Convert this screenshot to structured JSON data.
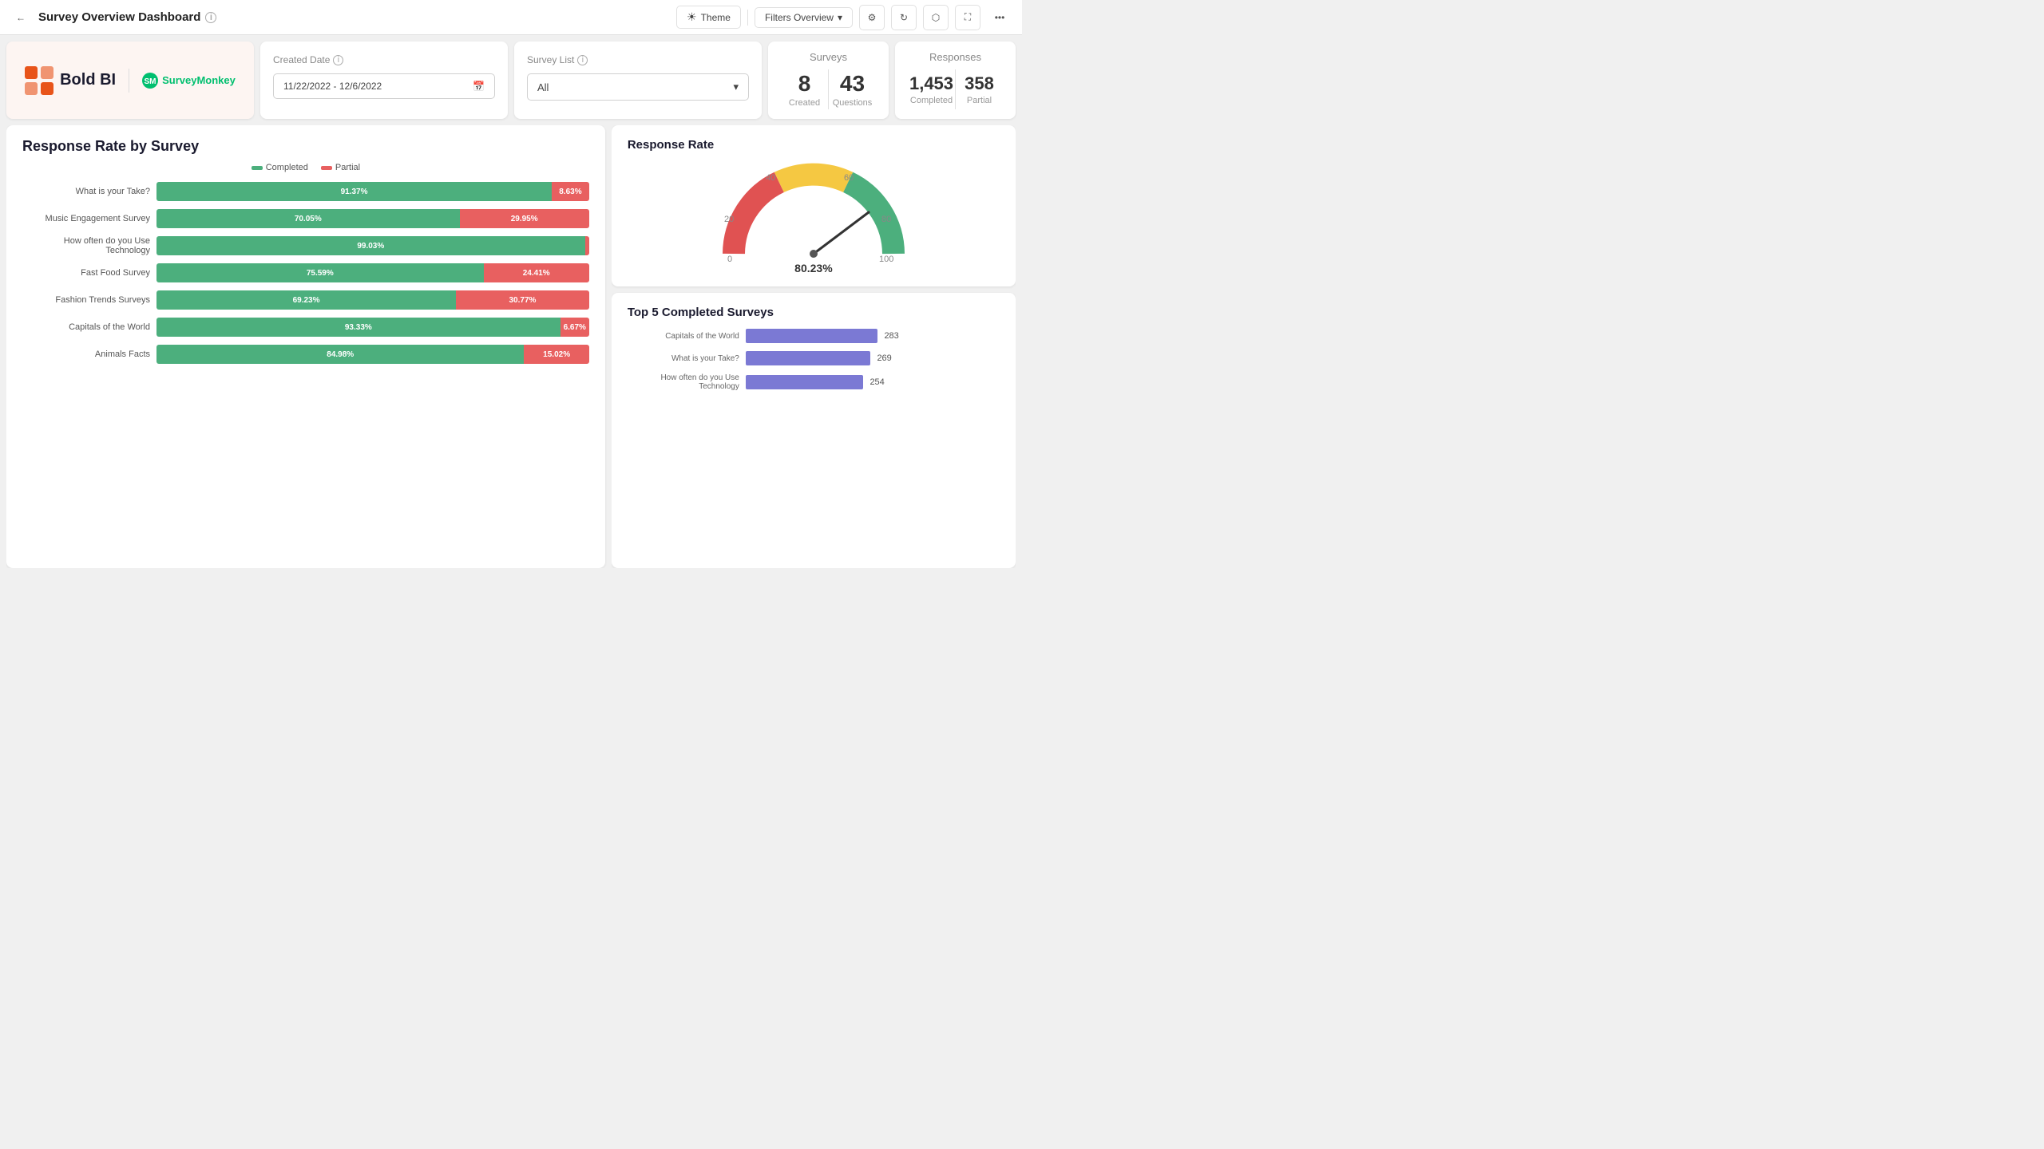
{
  "header": {
    "back_label": "←",
    "title": "Survey Overview Dashboard",
    "theme_label": "Theme",
    "filters_label": "Filters Overview",
    "info_icon": "ℹ",
    "sun_icon": "☀",
    "chevron_icon": "▾",
    "filter_icon": "⚙",
    "refresh_icon": "↻",
    "share_icon": "⬡",
    "expand_icon": "⛶",
    "more_icon": "•••"
  },
  "logo_card": {
    "boldbi_text": "Bold BI",
    "surveymonkey_text": "SurveyMonkey"
  },
  "date_card": {
    "label": "Created Date",
    "value": "11/22/2022 - 12/6/2022",
    "calendar_icon": "📅"
  },
  "survey_list_card": {
    "label": "Survey List",
    "value": "All",
    "chevron": "▾"
  },
  "surveys_card": {
    "title": "Surveys",
    "created_number": "8",
    "created_label": "Created",
    "questions_number": "43",
    "questions_label": "Questions"
  },
  "responses_card": {
    "title": "Responses",
    "completed_number": "1,453",
    "completed_label": "Completed",
    "partial_number": "358",
    "partial_label": "Partial"
  },
  "chart": {
    "title": "Response Rate by Survey",
    "legend_completed": "Completed",
    "legend_partial": "Partial",
    "bars": [
      {
        "label": "What is your Take?",
        "completed": 91.37,
        "partial": 8.63
      },
      {
        "label": "Music Engagement Survey",
        "completed": 70.05,
        "partial": 29.95
      },
      {
        "label": "How often do you Use Technology",
        "completed": 99.03,
        "partial": 0.97
      },
      {
        "label": "Fast Food Survey",
        "completed": 75.59,
        "partial": 24.41
      },
      {
        "label": "Fashion Trends Surveys",
        "completed": 69.23,
        "partial": 30.77
      },
      {
        "label": "Capitals of the World",
        "completed": 93.33,
        "partial": 6.67
      },
      {
        "label": "Animals Facts",
        "completed": 84.98,
        "partial": 15.02
      }
    ]
  },
  "gauge": {
    "title": "Response Rate",
    "value": 80.23,
    "value_label": "80.23%",
    "ticks": [
      "0",
      "20",
      "40",
      "60",
      "80",
      "100"
    ]
  },
  "top5": {
    "title": "Top 5 Completed Surveys",
    "bars": [
      {
        "label": "Capitals of the World",
        "value": 283,
        "width_pct": 92
      },
      {
        "label": "What is your Take?",
        "value": 269,
        "width_pct": 87
      },
      {
        "label": "How often do you Use Technology",
        "value": 254,
        "width_pct": 82
      }
    ]
  },
  "colors": {
    "green": "#4caf7d",
    "red": "#e86060",
    "purple": "#7b79d4",
    "accent_orange": "#e8541a",
    "gauge_red": "#e05252",
    "gauge_yellow": "#f5c842",
    "gauge_green": "#4caf7d"
  }
}
